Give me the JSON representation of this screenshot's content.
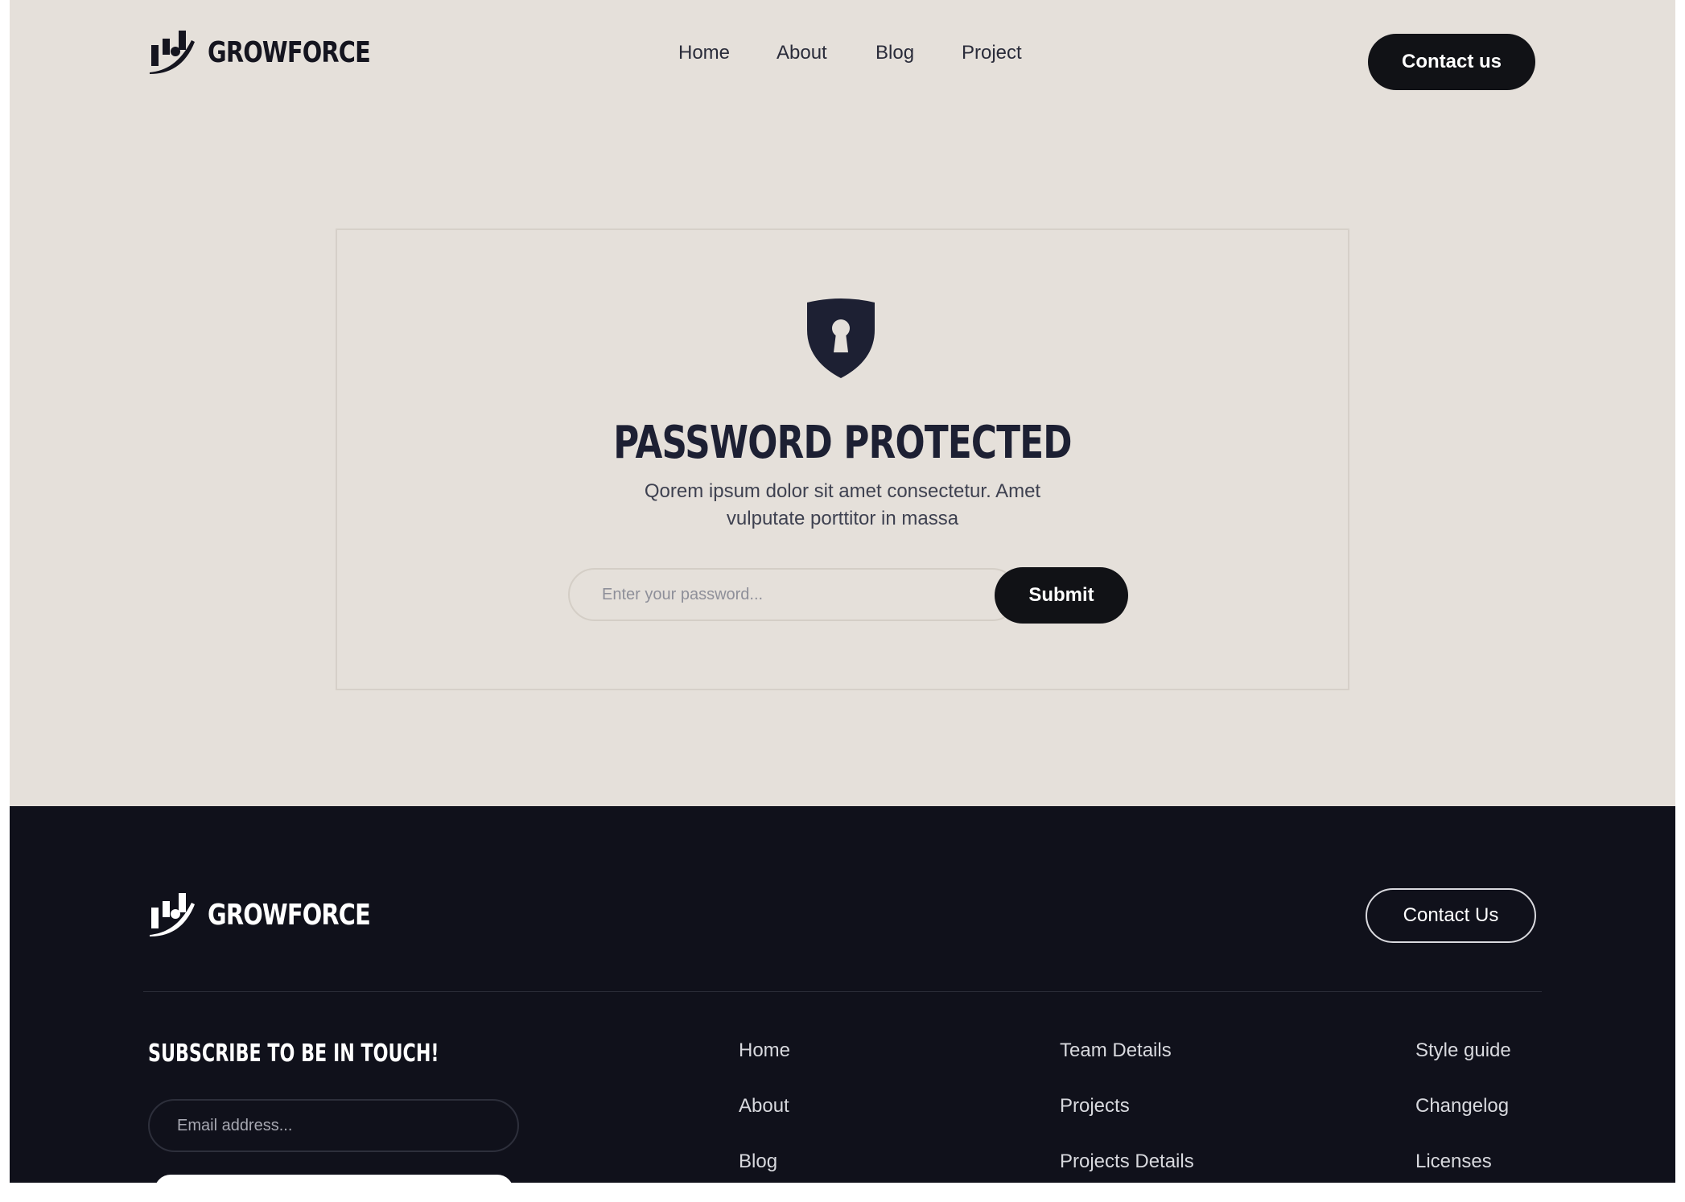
{
  "brand": {
    "name": "GROWFORCE"
  },
  "nav": {
    "items": [
      {
        "label": "Home"
      },
      {
        "label": "About"
      },
      {
        "label": "Blog"
      },
      {
        "label": "Project"
      }
    ],
    "contact_label": "Contact us"
  },
  "protected": {
    "icon": "shield-keyhole-icon",
    "title": "PASSWORD PROTECTED",
    "description": "Qorem ipsum dolor sit amet consectetur. Amet vulputate porttitor in massa",
    "password_placeholder": "Enter your password...",
    "password_value": "",
    "submit_label": "Submit"
  },
  "footer": {
    "contact_label": "Contact Us",
    "subscribe_title": "SUBSCRIBE TO BE IN TOUCH!",
    "email_placeholder": "Email address...",
    "links_col1": [
      "Home",
      "About",
      "Blog"
    ],
    "links_col2": [
      "Team Details",
      "Projects",
      "Projects Details"
    ],
    "links_col3": [
      "Style guide",
      "Changelog",
      "Licenses"
    ]
  },
  "colors": {
    "page_bg": "#e5e0da",
    "footer_bg": "#10111b",
    "dark_button": "#111216",
    "heading": "#1d2033"
  }
}
